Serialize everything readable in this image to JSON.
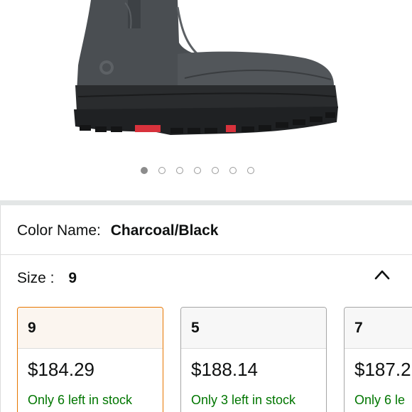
{
  "gallery": {
    "dots_total": 7,
    "active_index": 0
  },
  "color": {
    "label": "Color Name:",
    "value": "Charcoal/Black"
  },
  "size": {
    "label": "Size :",
    "value": "9"
  },
  "size_options": [
    {
      "size": "9",
      "price": "$184.29",
      "stock": "Only 6 left in stock",
      "selected": true
    },
    {
      "size": "5",
      "price": "$188.14",
      "stock": "Only 3 left in stock",
      "selected": false
    },
    {
      "size": "7",
      "price": "$187.2",
      "stock": "Only 6 le",
      "selected": false
    }
  ],
  "colors": {
    "accent_selected_border": "#e77600",
    "in_stock_green": "#007600",
    "boot_sole_red": "#d8323c"
  },
  "icons": {
    "collapse": "chevron-up-icon"
  }
}
